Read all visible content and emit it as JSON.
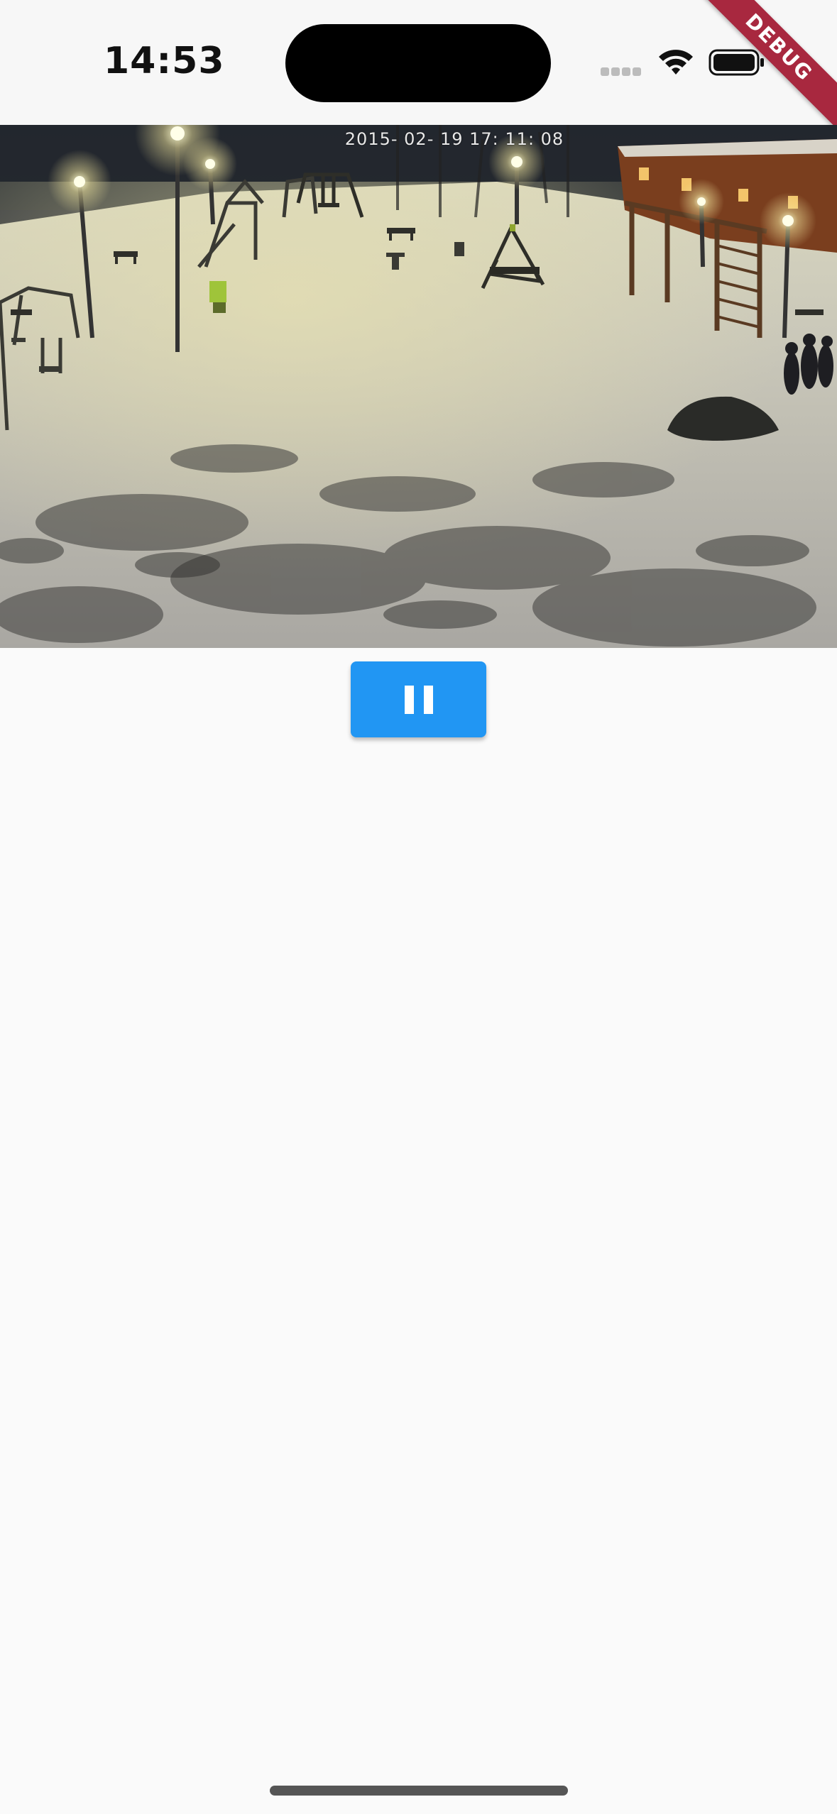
{
  "status_bar": {
    "time": "14:53",
    "icons": [
      "cellular-signal-icon",
      "wifi-icon",
      "battery-icon"
    ]
  },
  "debug_banner": {
    "label": "DEBUG",
    "color": "#a8283f"
  },
  "video": {
    "timestamp": "2015- 02- 19  17: 11: 08"
  },
  "controls": {
    "pause_icon": "pause-icon",
    "button_color": "#2196f3"
  }
}
